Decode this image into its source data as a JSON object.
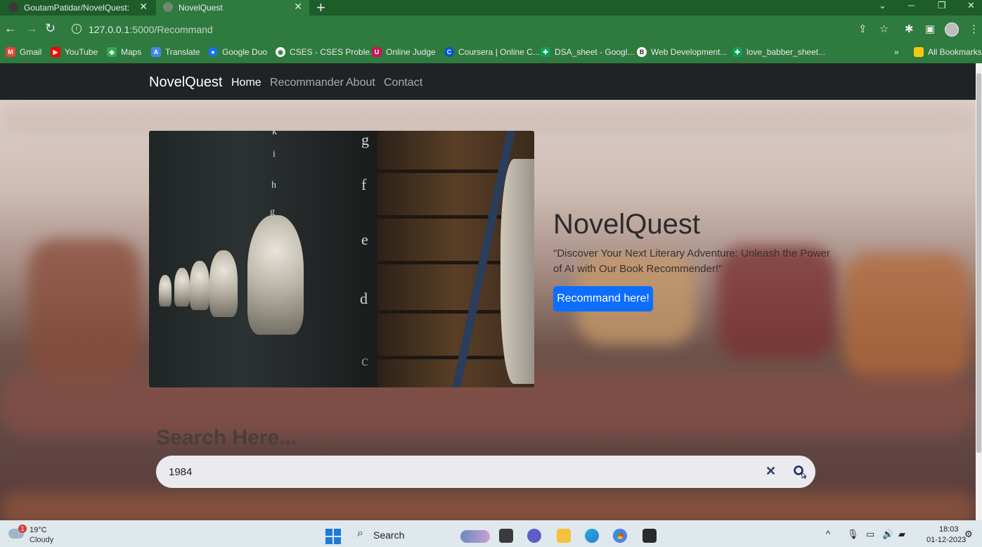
{
  "browser": {
    "tabs": [
      {
        "title": "GoutamPatidar/NovelQuest: \"No"
      },
      {
        "title": "NovelQuest"
      }
    ],
    "url_host": "127.0.0.1",
    "url_path": ":5000/Recommand",
    "bookmarks": [
      {
        "label": "Gmail",
        "color": "#ea4335"
      },
      {
        "label": "YouTube",
        "color": "#ff0000"
      },
      {
        "label": "Maps",
        "color": "#34a853"
      },
      {
        "label": "Translate",
        "color": "#4285f4"
      },
      {
        "label": "Google Duo",
        "color": "#1a73e8"
      },
      {
        "label": "CSES - CSES Proble...",
        "color": "#ffffff"
      },
      {
        "label": "Online Judge",
        "color": "#c2185b"
      },
      {
        "label": "Coursera | Online C...",
        "color": "#0056d2"
      },
      {
        "label": "DSA_sheet - Googl...",
        "color": "#0f9d58"
      },
      {
        "label": "Web Development...",
        "color": "#222222"
      },
      {
        "label": "love_babber_sheet...",
        "color": "#0f9d58"
      }
    ],
    "bookmarks_overflow": "»",
    "all_bookmarks": "All Bookmarks"
  },
  "site": {
    "brand": "NovelQuest",
    "nav": [
      {
        "label": "Home",
        "active": true
      },
      {
        "label": "Recommander",
        "active": false
      },
      {
        "label": "About",
        "active": false
      },
      {
        "label": "Contact",
        "active": false
      }
    ],
    "hero": {
      "title": "NovelQuest",
      "quote": "\"Discover Your Next Literary Adventure: Unleash the Power of AI with Our Book Recommender!\"",
      "cta": "Recommand here!",
      "pillar_letters": [
        "g",
        "f",
        "e",
        "d",
        "c"
      ],
      "left_letters": [
        "k",
        "i",
        "h",
        "g"
      ]
    },
    "search": {
      "heading": "Search Here...",
      "value": "1984",
      "clear": "✕"
    }
  },
  "taskbar": {
    "weather_badge": "1",
    "temperature": "19°C",
    "condition": "Cloudy",
    "search_label": "Search",
    "time": "18:03",
    "date": "01-12-2023"
  },
  "colors": {
    "accent": "#0d6efd",
    "navbar": "#1f2326",
    "browser_green": "#2f7a3e"
  }
}
